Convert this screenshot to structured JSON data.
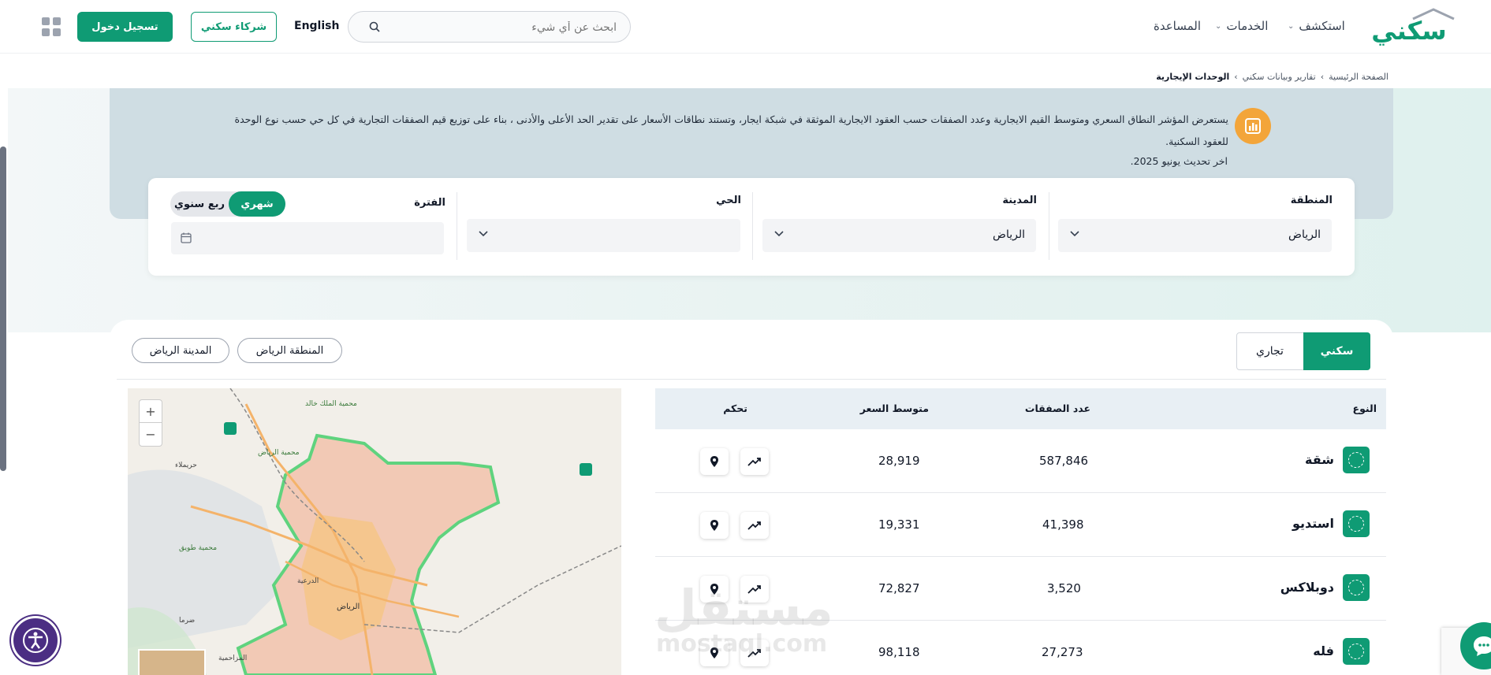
{
  "header": {
    "logo_text": "سكني",
    "nav": {
      "explore": "استكشف",
      "services": "الخدمات",
      "help": "المساعدة"
    },
    "search_placeholder": "ابحث عن أي شيء",
    "lang": "English",
    "partners": "شركاء سكني",
    "login": "تسجيل دخول"
  },
  "breadcrumb": {
    "home": "الصفحة الرئيسية",
    "reports": "تقارير وبيانات سكني",
    "current": "الوحدات الإيجارية"
  },
  "info": {
    "text": "يستعرض المؤشر النطاق السعري ومتوسط القيم الايجارية وعدد الصفقات حسب العقود الايجارية الموثقة في شبكة ايجار، وتستند نطاقات الأسعار على تقدير الحد الأعلى والأدنى ، بناء على توزيع قيم الصفقات التجارية في كل حي حسب نوع الوحدة للعقود السكنية.",
    "updated": "اخر تحديث يونيو 2025."
  },
  "filters": {
    "region_label": "المنطقة",
    "region_value": "الرياض",
    "city_label": "المدينة",
    "city_value": "الرياض",
    "district_label": "الحي",
    "district_value": "",
    "period_label": "الفترة",
    "toggle_monthly": "شهري",
    "toggle_quarterly": "ربع سنوي"
  },
  "tabs": {
    "residential": "سكني",
    "commercial": "تجاري"
  },
  "chips": {
    "region": "المنطقة الرياض",
    "city": "المدينة الرياض"
  },
  "table": {
    "headers": {
      "type": "النوع",
      "deals": "عدد الصفقات",
      "avg_price": "متوسط السعر",
      "control": "تحكم"
    },
    "rows": [
      {
        "type": "شقة",
        "deals": "587,846",
        "avg_price": "28,919"
      },
      {
        "type": "استديو",
        "deals": "41,398",
        "avg_price": "19,331"
      },
      {
        "type": "دوبلاكس",
        "deals": "3,520",
        "avg_price": "72,827"
      },
      {
        "type": "فله",
        "deals": "27,273",
        "avg_price": "98,118"
      }
    ]
  },
  "map": {
    "labels": {
      "khalid_reserve": "محمية الملك خالد",
      "riyadh": "الرياض",
      "dariyah": "الدرعية",
      "huraymila": "حريملاء",
      "tuwaiq": "محمية طويق",
      "dirma": "ضرما",
      "muzahmiyah": "المزاحمية",
      "reserve_r": "محمية الرياض"
    },
    "zoom_in": "+",
    "zoom_out": "−"
  },
  "watermark": {
    "ar": "مستقل",
    "en": "mostaql.com"
  },
  "colors": {
    "brand": "#0f9b74",
    "info_bg": "#cfdde3",
    "accent": "#f3a53a"
  }
}
